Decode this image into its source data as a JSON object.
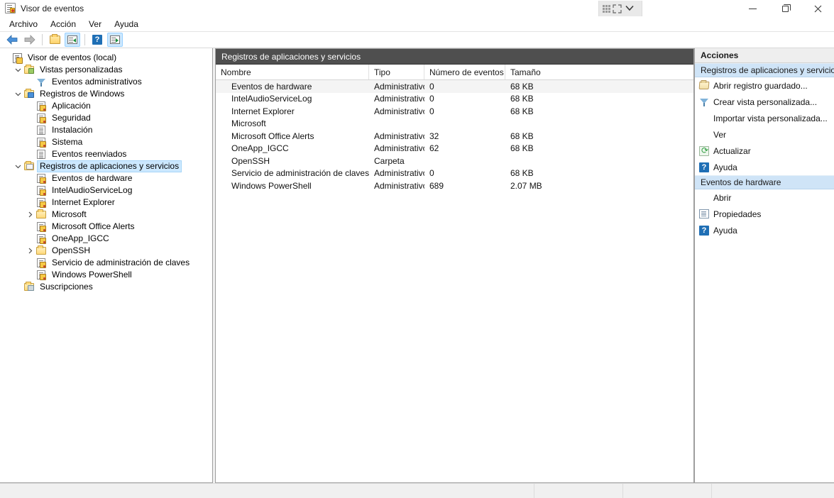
{
  "window": {
    "title": "Visor de eventos",
    "title_icon": "event-viewer-icon",
    "minimize_label": "—",
    "maximize_label": "❐",
    "close_label": "✕",
    "snap_grip_icon": "grip-dots-icon",
    "snap_expand_icon": "expand-arrows-icon",
    "snap_chevron_icon": "chevron-down-icon"
  },
  "menubar": {
    "items": [
      {
        "label": "Archivo"
      },
      {
        "label": "Acción"
      },
      {
        "label": "Ver"
      },
      {
        "label": "Ayuda"
      }
    ]
  },
  "toolbar": {
    "buttons": [
      {
        "name": "back-button",
        "icon": "arrow-left-icon",
        "glyph": "⇦",
        "color": "#3b7dd8",
        "selected": false
      },
      {
        "name": "forward-button",
        "icon": "arrow-right-icon",
        "glyph": "⇨",
        "color": "#8d8d8d",
        "selected": false
      },
      {
        "name": "open-saved-log-button",
        "icon": "open-folder-icon",
        "glyph": "",
        "selected": false
      },
      {
        "name": "show-hide-console-tree-button",
        "icon": "console-tree-icon",
        "glyph": "",
        "selected": true
      },
      {
        "name": "help-button",
        "icon": "help-icon",
        "glyph": "?",
        "selected": false
      },
      {
        "name": "show-hide-action-pane-button",
        "icon": "action-pane-icon",
        "glyph": "",
        "selected": true
      }
    ]
  },
  "tree": {
    "items": [
      {
        "label": "Visor de eventos (local)",
        "indent": 0,
        "twisty": "",
        "icon": "event-viewer-root-icon",
        "selected": false
      },
      {
        "label": "Vistas personalizadas",
        "indent": 1,
        "twisty": "⌄",
        "icon": "custom-views-folder-icon",
        "selected": false
      },
      {
        "label": "Eventos administrativos",
        "indent": 2,
        "twisty": "",
        "icon": "funnel-icon",
        "selected": false
      },
      {
        "label": "Registros de Windows",
        "indent": 1,
        "twisty": "⌄",
        "icon": "windows-logs-folder-icon",
        "selected": false
      },
      {
        "label": "Aplicación",
        "indent": 2,
        "twisty": "",
        "icon": "log-badged-icon",
        "selected": false
      },
      {
        "label": "Seguridad",
        "indent": 2,
        "twisty": "",
        "icon": "log-badged-icon",
        "selected": false
      },
      {
        "label": "Instalación",
        "indent": 2,
        "twisty": "",
        "icon": "log-icon",
        "selected": false
      },
      {
        "label": "Sistema",
        "indent": 2,
        "twisty": "",
        "icon": "log-badged-icon",
        "selected": false
      },
      {
        "label": "Eventos reenviados",
        "indent": 2,
        "twisty": "",
        "icon": "log-icon",
        "selected": false
      },
      {
        "label": "Registros de aplicaciones y servicios",
        "indent": 1,
        "twisty": "⌄",
        "icon": "app-services-folder-icon",
        "selected": true
      },
      {
        "label": "Eventos de hardware",
        "indent": 2,
        "twisty": "",
        "icon": "log-badged-icon",
        "selected": false
      },
      {
        "label": "IntelAudioServiceLog",
        "indent": 2,
        "twisty": "",
        "icon": "log-badged-icon",
        "selected": false
      },
      {
        "label": "Internet Explorer",
        "indent": 2,
        "twisty": "",
        "icon": "log-badged-icon",
        "selected": false
      },
      {
        "label": "Microsoft",
        "indent": 2,
        "twisty": "›",
        "icon": "folder-icon",
        "selected": false
      },
      {
        "label": "Microsoft Office Alerts",
        "indent": 2,
        "twisty": "",
        "icon": "log-badged-icon",
        "selected": false
      },
      {
        "label": "OneApp_IGCC",
        "indent": 2,
        "twisty": "",
        "icon": "log-badged-icon",
        "selected": false
      },
      {
        "label": "OpenSSH",
        "indent": 2,
        "twisty": "›",
        "icon": "folder-icon",
        "selected": false
      },
      {
        "label": "Servicio de administración de claves",
        "indent": 2,
        "twisty": "",
        "icon": "log-badged-icon",
        "selected": false
      },
      {
        "label": "Windows PowerShell",
        "indent": 2,
        "twisty": "",
        "icon": "log-badged-icon",
        "selected": false
      },
      {
        "label": "Suscripciones",
        "indent": 1,
        "twisty": "",
        "icon": "subscriptions-folder-icon",
        "selected": false
      }
    ]
  },
  "main": {
    "header_title": "Registros de aplicaciones y servicios",
    "columns": [
      "Nombre",
      "Tipo",
      "Número de eventos",
      "Tamaño"
    ],
    "rows": [
      {
        "name": "Eventos de hardware",
        "type": "Administrativo",
        "count": "0",
        "size": "68 KB",
        "highlighted": true
      },
      {
        "name": "IntelAudioServiceLog",
        "type": "Administrativo",
        "count": "0",
        "size": "68 KB",
        "highlighted": false
      },
      {
        "name": "Internet Explorer",
        "type": "Administrativo",
        "count": "0",
        "size": "68 KB",
        "highlighted": false
      },
      {
        "name": "Microsoft",
        "type": "",
        "count": "",
        "size": "",
        "highlighted": false
      },
      {
        "name": "Microsoft Office Alerts",
        "type": "Administrativo",
        "count": "32",
        "size": "68 KB",
        "highlighted": false
      },
      {
        "name": "OneApp_IGCC",
        "type": "Administrativo",
        "count": "62",
        "size": "68 KB",
        "highlighted": false
      },
      {
        "name": "OpenSSH",
        "type": "Carpeta",
        "count": "",
        "size": "",
        "highlighted": false
      },
      {
        "name": "Servicio de administración de claves",
        "type": "Administrativo",
        "count": "0",
        "size": "68 KB",
        "highlighted": false
      },
      {
        "name": "Windows PowerShell",
        "type": "Administrativo",
        "count": "689",
        "size": "2.07 MB",
        "highlighted": false
      }
    ]
  },
  "actions": {
    "title": "Acciones",
    "groups": [
      {
        "header": "Registros de aplicaciones y servicios",
        "items": [
          {
            "label": "Abrir registro guardado...",
            "icon": "open-folder-icon"
          },
          {
            "label": "Crear vista personalizada...",
            "icon": "funnel-icon"
          },
          {
            "label": "Importar vista personalizada...",
            "icon": ""
          },
          {
            "label": "Ver",
            "icon": ""
          },
          {
            "label": "Actualizar",
            "icon": "refresh-icon"
          },
          {
            "label": "Ayuda",
            "icon": "help-icon"
          }
        ]
      },
      {
        "header": "Eventos de hardware",
        "items": [
          {
            "label": "Abrir",
            "icon": ""
          },
          {
            "label": "Propiedades",
            "icon": "properties-icon"
          },
          {
            "label": "Ayuda",
            "icon": "help-icon"
          }
        ]
      }
    ]
  },
  "colors": {
    "selection_blue": "#cce8ff",
    "section_header_blue": "#cfe4f7",
    "main_header_gray": "#4f4f4f",
    "row_highlight": "#f4f4f4"
  }
}
